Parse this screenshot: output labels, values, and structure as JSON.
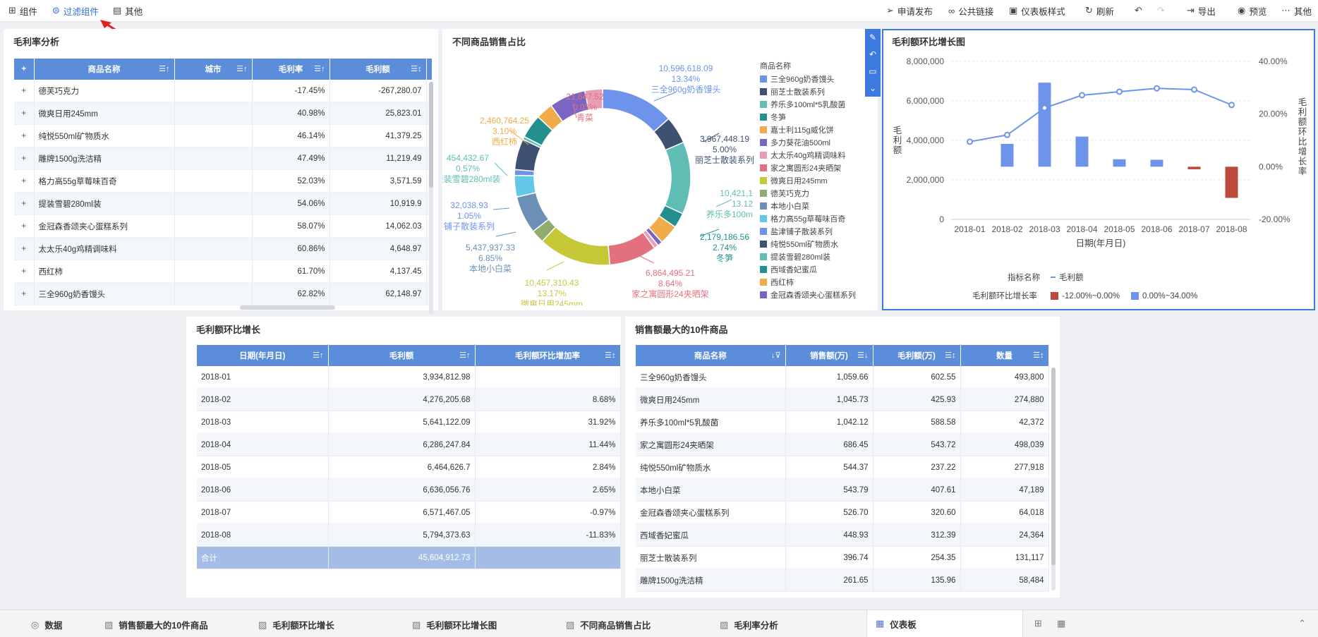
{
  "toolbar": {
    "left": [
      {
        "label": "组件",
        "icon": "component-icon"
      },
      {
        "label": "过滤组件",
        "icon": "filter-icon"
      },
      {
        "label": "其他",
        "icon": "other-icon"
      }
    ],
    "right": [
      {
        "label": "申请发布",
        "icon": "send-icon"
      },
      {
        "label": "公共链接",
        "icon": "link-icon"
      },
      {
        "label": "仪表板样式",
        "icon": "style-icon"
      },
      {
        "label": "刷新",
        "icon": "refresh-icon"
      },
      {
        "label": "导出",
        "icon": "export-icon"
      },
      {
        "label": "预览",
        "icon": "preview-icon"
      },
      {
        "label": "其他",
        "icon": "more-icon"
      }
    ]
  },
  "margin_table": {
    "title": "毛利率分析",
    "columns": [
      "商品名称",
      "城市",
      "毛利率",
      "毛利额"
    ],
    "rows": [
      [
        "德芙巧克力",
        "",
        "-17.45%",
        "-267,280.07"
      ],
      [
        "微爽日用245mm",
        "",
        "40.98%",
        "25,823.01"
      ],
      [
        "纯悦550ml矿物质水",
        "",
        "46.14%",
        "41,379.25"
      ],
      [
        "雕牌1500g洗洁精",
        "",
        "47.49%",
        "11,219.49"
      ],
      [
        "格力高55g草莓味百奇",
        "",
        "52.03%",
        "3,571.59"
      ],
      [
        "提装雪碧280ml装",
        "",
        "54.06%",
        "10,919.9"
      ],
      [
        "金冠森香颂夹心蛋糕系列",
        "",
        "58.07%",
        "14,062.03"
      ],
      [
        "太太乐40g鸡精调味料",
        "",
        "60.86%",
        "4,648.97"
      ],
      [
        "西红柿",
        "",
        "61.70%",
        "4,137.45"
      ],
      [
        "三全960g奶香馒头",
        "",
        "62.82%",
        "62,148.97"
      ]
    ]
  },
  "pie_panel": {
    "title": "不同商品销售占比",
    "legend_title": "商品名称",
    "legend": [
      {
        "label": "三全960g奶香馒头",
        "color": "#6d94ea"
      },
      {
        "label": "丽芝士散装系列",
        "color": "#3f5171"
      },
      {
        "label": "养乐多100ml*5乳酸菌",
        "color": "#5fbdb4"
      },
      {
        "label": "冬笋",
        "color": "#23908f"
      },
      {
        "label": "嘉士利115g威化饼",
        "color": "#f0ab4b"
      },
      {
        "label": "多力葵花油500ml",
        "color": "#7a64c4"
      },
      {
        "label": "太太乐40g鸡精调味料",
        "color": "#e99fb3"
      },
      {
        "label": "家之寓圆形24夹晒架",
        "color": "#e3707f"
      },
      {
        "label": "微爽日用245mm",
        "color": "#c7c838"
      },
      {
        "label": "德芙巧克力",
        "color": "#8fab6e"
      },
      {
        "label": "本地小白菜",
        "color": "#6c8fb5"
      },
      {
        "label": "格力高55g草莓味百奇",
        "color": "#64c7e5"
      },
      {
        "label": "盐津铺子散装系列",
        "color": "#6d94ea"
      },
      {
        "label": "纯悦550ml矿物质水",
        "color": "#3f5171"
      },
      {
        "label": "提装雪碧280ml装",
        "color": "#5fbdb4"
      },
      {
        "label": "西域香妃蜜瓜",
        "color": "#23908f"
      },
      {
        "label": "西红柿",
        "color": "#f0ab4b"
      },
      {
        "label": "金冠森香颂夹心蛋糕系列",
        "color": "#7a64c4"
      }
    ],
    "labels": [
      {
        "v": "10,596,618.09",
        "p": "13.34%",
        "n": "三全960g奶香馒头",
        "color": "#6d94ea"
      },
      {
        "v": "3,967,448.19",
        "p": "5.00%",
        "n": "丽芝士散装系列",
        "color": "#3f5171"
      },
      {
        "v": "10,421,1",
        "p": "13.12",
        "n": "养乐多100m",
        "color": "#5fbdb4"
      },
      {
        "v": "2,179,186.56",
        "p": "2.74%",
        "n": "冬笋",
        "color": "#23908f"
      },
      {
        "v": "6,864,495.21",
        "p": "8.64%",
        "n": "家之寓圆形24夹晒架",
        "color": "#e3707f"
      },
      {
        "v": "10,457,310.43",
        "p": "13.17%",
        "n": "微爽日用245mm",
        "color": "#c7c838"
      },
      {
        "v": "5,437,937.33",
        "p": "6.85%",
        "n": "本地小白菜",
        "color": "#6c8fb5"
      },
      {
        "v": "32,038.93",
        "p": "1.05%",
        "n": "铺子散装系列",
        "color": "#6d94ea"
      },
      {
        "v": "454,432.67",
        "p": "0.57%",
        "n": "提装雪碧280ml装",
        "color": "#5fbdb4"
      },
      {
        "v": "2,460,764.25",
        "p": "3.10%",
        "n": "西红柿",
        "color": "#f0ab4b"
      },
      {
        "v": "21,647.52",
        "p": "0.03%",
        "n": "青菜",
        "color": "#e3707f"
      }
    ]
  },
  "chart_data": {
    "type": "bar",
    "title": "毛利额环比增长图",
    "categories": [
      "2018-01",
      "2018-02",
      "2018-03",
      "2018-04",
      "2018-05",
      "2018-06",
      "2018-07",
      "2018-08"
    ],
    "series": [
      {
        "name": "毛利额",
        "kind": "line",
        "axis": "left",
        "values": [
          3934812.98,
          4276205.68,
          5641122.09,
          6286247.84,
          6464626.7,
          6636056.76,
          6571467.05,
          5794373.63
        ]
      },
      {
        "kind": "bar",
        "axis": "right",
        "values": [
          0,
          8.68,
          31.92,
          11.44,
          2.84,
          2.65,
          -0.97,
          -11.83
        ]
      }
    ],
    "xlabel": "日期(年月日)",
    "ylabel": "毛利额",
    "y2label": "毛利额环比增长率",
    "ylim": [
      0,
      8000000
    ],
    "y2lim": [
      -20,
      40
    ],
    "yticks": [
      "8,000,000",
      "6,000,000",
      "4,000,000",
      "2,000,000",
      "0"
    ],
    "y2ticks": [
      "40.00%",
      "20.00%",
      "0.00%",
      "-20.00%"
    ],
    "legend_metric_title": "指标名称",
    "legend_metric": "毛利额",
    "legend_rate_title": "毛利额环比增长率",
    "legend_ranges": [
      {
        "label": "-12.00%~0.00%",
        "color": "#b94a3c"
      },
      {
        "label": "0.00%~34.00%",
        "color": "#6d94ea"
      }
    ],
    "grid": true,
    "legend_position": "bottom"
  },
  "growth_table": {
    "title": "毛利额环比增长",
    "columns": [
      "日期(年月日)",
      "毛利额",
      "毛利额环比增加率"
    ],
    "rows": [
      [
        "2018-01",
        "3,934,812.98",
        ""
      ],
      [
        "2018-02",
        "4,276,205.68",
        "8.68%"
      ],
      [
        "2018-03",
        "5,641,122.09",
        "31.92%"
      ],
      [
        "2018-04",
        "6,286,247.84",
        "11.44%"
      ],
      [
        "2018-05",
        "6,464,626.7",
        "2.84%"
      ],
      [
        "2018-06",
        "6,636,056.76",
        "2.65%"
      ],
      [
        "2018-07",
        "6,571,467.05",
        "-0.97%"
      ],
      [
        "2018-08",
        "5,794,373.63",
        "-11.83%"
      ]
    ],
    "total": [
      "合计",
      "45,604,912.73",
      ""
    ]
  },
  "top10_table": {
    "title": "销售额最大的10件商品",
    "columns": [
      "商品名称",
      "销售额(万)",
      "毛利额(万)",
      "数量"
    ],
    "rows": [
      [
        "三全960g奶香馒头",
        "1,059.66",
        "602.55",
        "493,800"
      ],
      [
        "微爽日用245mm",
        "1,045.73",
        "425.93",
        "274,880"
      ],
      [
        "养乐多100ml*5乳酸菌",
        "1,042.12",
        "588.58",
        "42,372"
      ],
      [
        "家之寓圆形24夹晒架",
        "686.45",
        "543.72",
        "498,039"
      ],
      [
        "纯悦550ml矿物质水",
        "544.37",
        "237.22",
        "277,918"
      ],
      [
        "本地小白菜",
        "543.79",
        "407.61",
        "47,189"
      ],
      [
        "金冠森香颂夹心蛋糕系列",
        "526.70",
        "320.60",
        "64,018"
      ],
      [
        "西域香妃蜜瓜",
        "448.93",
        "312.39",
        "24,364"
      ],
      [
        "丽芝士散装系列",
        "396.74",
        "254.35",
        "131,117"
      ],
      [
        "雕牌1500g洗洁精",
        "261.65",
        "135.96",
        "58,484"
      ]
    ]
  },
  "bottom_tabs": [
    {
      "label": "数据",
      "icon": "database-icon"
    },
    {
      "label": "销售额最大的10件商品",
      "icon": "chart-tab-icon"
    },
    {
      "label": "毛利额环比增长",
      "icon": "chart-tab-icon"
    },
    {
      "label": "毛利额环比增长图",
      "icon": "chart-tab-icon"
    },
    {
      "label": "不同商品销售占比",
      "icon": "chart-tab-icon"
    },
    {
      "label": "毛利率分析",
      "icon": "chart-tab-icon"
    },
    {
      "label": "仪表板",
      "icon": "dashboard-icon"
    }
  ]
}
